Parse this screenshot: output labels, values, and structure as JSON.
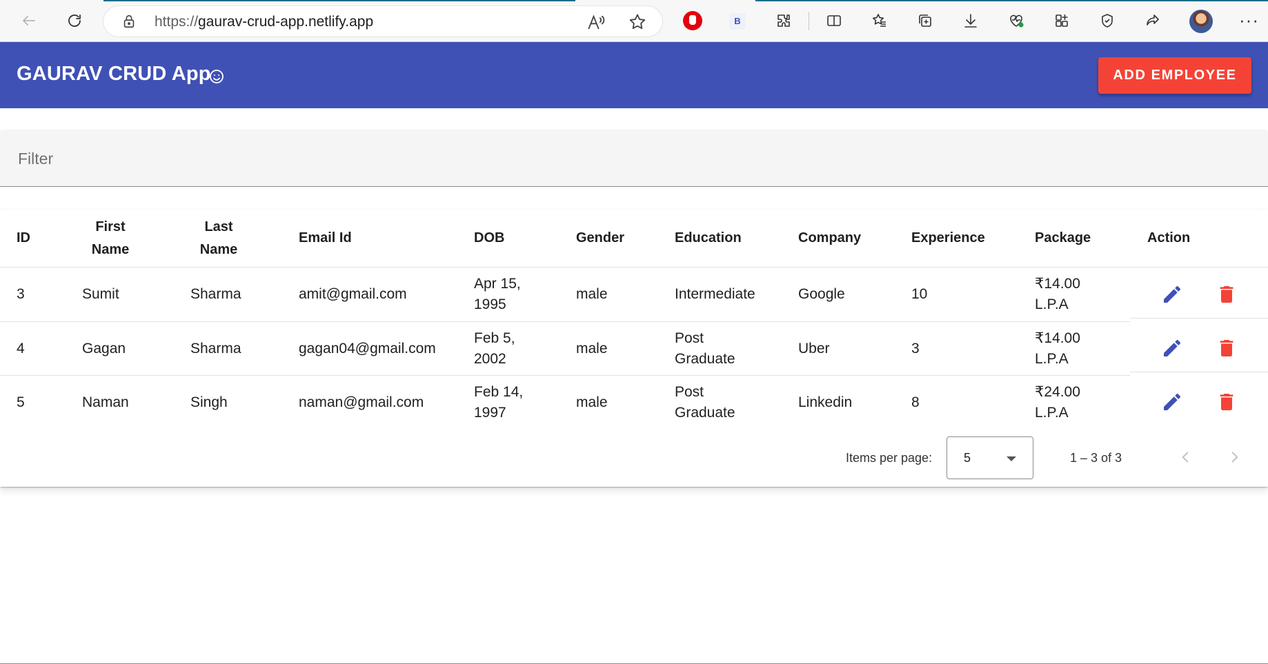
{
  "browser": {
    "url_scheme": "https://",
    "url_host": "gaurav-crud-app.netlify.app",
    "extension_b_label": "B"
  },
  "toolbar": {
    "title": "GAURAV CRUD App",
    "add_button_label": "ADD EMPLOYEE"
  },
  "filter": {
    "placeholder": "Filter",
    "value": ""
  },
  "table": {
    "columns": [
      "ID",
      "First Name",
      "Last Name",
      "Email Id",
      "DOB",
      "Gender",
      "Education",
      "Company",
      "Experience",
      "Package",
      "Action"
    ],
    "rows": [
      {
        "id": "3",
        "first_name": "Sumit",
        "last_name": "Sharma",
        "email": "amit@gmail.com",
        "dob": "Apr 15, 1995",
        "gender": "male",
        "education": "Intermediate",
        "company": "Google",
        "experience": "10",
        "package": "₹14.00 L.P.A"
      },
      {
        "id": "4",
        "first_name": "Gagan",
        "last_name": "Sharma",
        "email": "gagan04@gmail.com",
        "dob": "Feb 5, 2002",
        "gender": "male",
        "education": "Post Graduate",
        "company": "Uber",
        "experience": "3",
        "package": "₹14.00 L.P.A"
      },
      {
        "id": "5",
        "first_name": "Naman",
        "last_name": "Singh",
        "email": "naman@gmail.com",
        "dob": "Feb 14, 1997",
        "gender": "male",
        "education": "Post Graduate",
        "company": "Linkedin",
        "experience": "8",
        "package": "₹24.00 L.P.A"
      }
    ]
  },
  "paginator": {
    "items_per_page_label": "Items per page:",
    "page_size": "5",
    "range_label": "1 – 3 of 3"
  },
  "colors": {
    "primary": "#3f51b5",
    "warn": "#f44336",
    "edit_icon": "#3f51b5",
    "delete_icon": "#f44336"
  }
}
